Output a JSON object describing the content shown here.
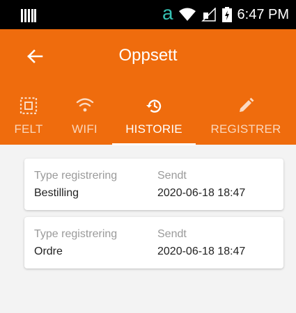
{
  "status_bar": {
    "time": "6:47 PM",
    "amazon_letter": "a"
  },
  "app_bar": {
    "title": "Oppsett"
  },
  "tabs": [
    {
      "label": "FELT",
      "icon": "dotted-square-icon",
      "active": false
    },
    {
      "label": "WIFI",
      "icon": "wifi-icon",
      "active": false
    },
    {
      "label": "HISTORIE",
      "icon": "history-icon",
      "active": true
    },
    {
      "label": "REGISTRER",
      "icon": "pencil-icon",
      "active": false
    }
  ],
  "history": {
    "type_label": "Type registrering",
    "sent_label": "Sendt",
    "rows": [
      {
        "type": "Bestilling",
        "sent": "2020-06-18 18:47"
      },
      {
        "type": "Ordre",
        "sent": "2020-06-18 18:47"
      }
    ]
  },
  "colors": {
    "accent": "#ef6c0d",
    "background": "#f3f3f3"
  }
}
